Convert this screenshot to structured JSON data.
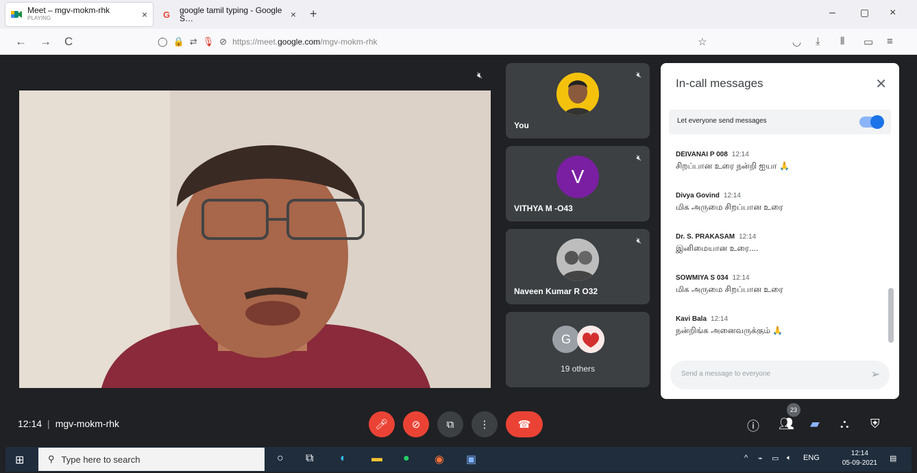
{
  "browser": {
    "tabs": [
      {
        "title": "Meet – mgv-mokm-rhk",
        "subtitle": "PLAYING",
        "close": "×"
      },
      {
        "title": "google tamil typing - Google S…",
        "close": "×"
      }
    ],
    "new_tab": "+",
    "window": {
      "minimize": "–",
      "restore": "▢",
      "close": "×"
    },
    "nav": {
      "back": "←",
      "forward": "→",
      "reload": "C"
    },
    "url": {
      "prefix": "https://meet.",
      "host": "google.com",
      "path": "/mgv-mokm-rhk"
    },
    "toolbar_icons": [
      "bookmark-star-icon",
      "pocket-icon",
      "download-icon",
      "library-icon",
      "sidebar-icon",
      "menu-icon"
    ]
  },
  "meet": {
    "tiles": [
      {
        "name": "You"
      },
      {
        "name": "VITHYA M -O43",
        "initial": "V"
      },
      {
        "name": "Naveen Kumar R O32"
      },
      {
        "name": "19 others",
        "initial": "G"
      }
    ],
    "panel": {
      "title": "In-call messages",
      "toggle_label": "Let everyone send messages",
      "toggle_on": true,
      "messages": [
        {
          "sender": "DEIVANAI P 008",
          "time": "12:14",
          "text": "சிறப்பான உரை நன்றி ஐயா 🙏"
        },
        {
          "sender": "Divya Govind",
          "time": "12:14",
          "text": "மிக அருமை சிறப்பான உரை"
        },
        {
          "sender": "Dr. S. PRAKASAM",
          "time": "12:14",
          "text": "இனிமையான உரை...."
        },
        {
          "sender": "SOWMIYA S 034",
          "time": "12:14",
          "text": "மிக அருமை சிறப்பான உரை"
        },
        {
          "sender": "Kavi Bala",
          "time": "12:14",
          "text": "நன்றிங்க அனைவருக்கும் 🙏"
        }
      ],
      "send_placeholder": "Send a message to everyone"
    },
    "bottom": {
      "time": "12:14",
      "sep": "|",
      "meeting_code": "mgv-mokm-rhk",
      "participants_count": "23"
    }
  },
  "taskbar": {
    "search_placeholder": "Type here to search",
    "lang": "ENG",
    "time": "12:14",
    "date": "05-09-2021"
  }
}
